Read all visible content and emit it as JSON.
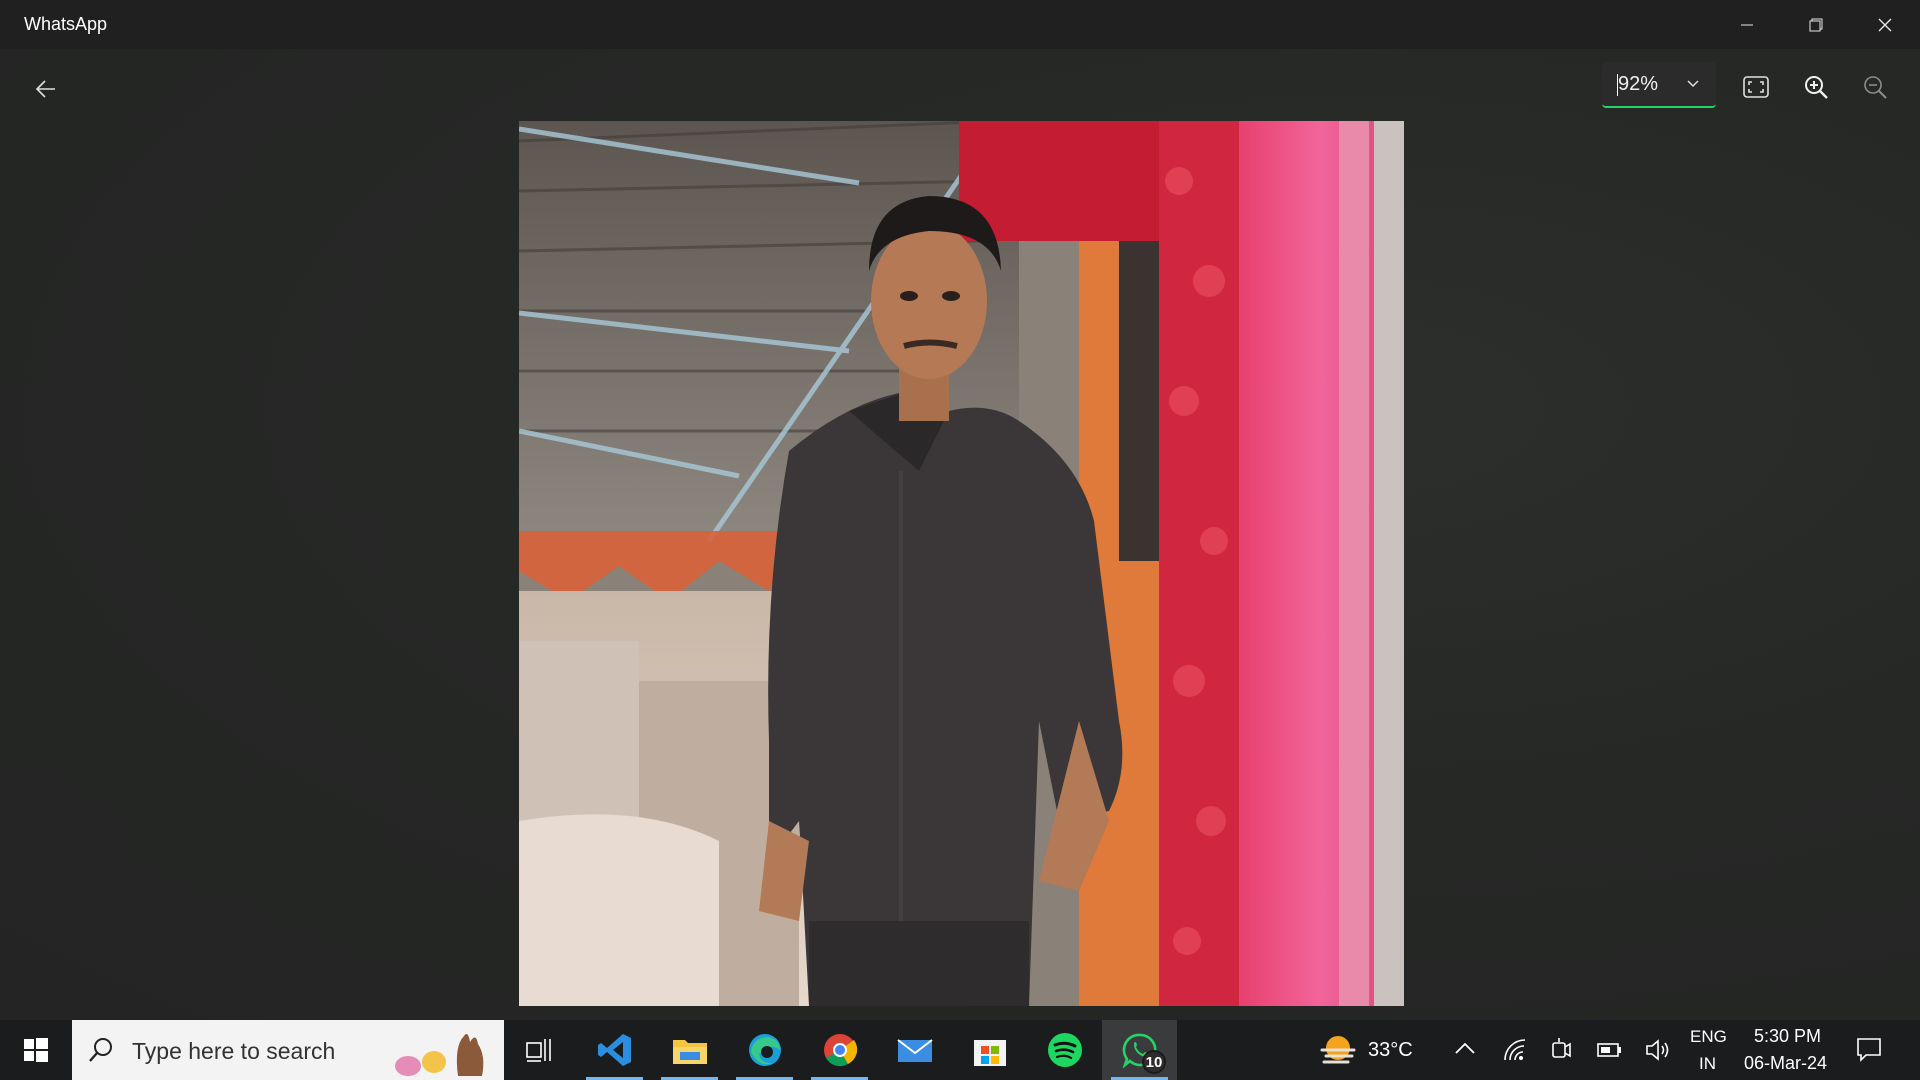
{
  "window": {
    "title": "WhatsApp"
  },
  "toolbar": {
    "zoom_value": "92%"
  },
  "taskbar": {
    "search_placeholder": "Type here to search",
    "weather_temp": "33°C",
    "language_line1": "ENG",
    "language_line2": "IN",
    "clock_time": "5:30 PM",
    "clock_date": "06-Mar-24",
    "whatsapp_badge": "10",
    "apps": [
      "task-view",
      "vscode",
      "file-explorer",
      "edge",
      "chrome",
      "mail",
      "microsoft-store",
      "spotify",
      "whatsapp"
    ]
  },
  "colors": {
    "accent_green": "#25d366",
    "taskbar_underline": "#77b7ef"
  }
}
